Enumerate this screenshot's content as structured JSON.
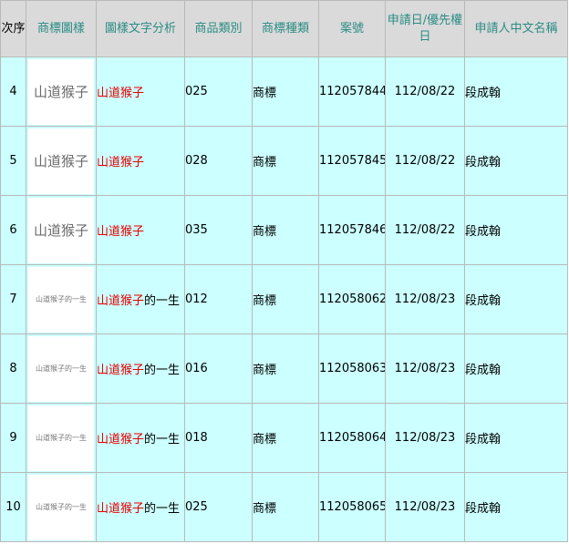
{
  "headers": {
    "seq": "次序",
    "image": "商標圖樣",
    "text": "圖樣文字分析",
    "class": "商品類別",
    "type": "商標種類",
    "app_no": "案號",
    "date": "申請日/優先權日",
    "applicant": "申請人中文名稱"
  },
  "rows": [
    {
      "seq": "4",
      "logo": "山道猴子",
      "text_red": "山道猴子",
      "text_rest": "",
      "class": "025",
      "type": "商標",
      "app_no": "112057844",
      "date": "112/08/22",
      "applicant": "段成翰"
    },
    {
      "seq": "5",
      "logo": "山道猴子",
      "text_red": "山道猴子",
      "text_rest": "",
      "class": "028",
      "type": "商標",
      "app_no": "112057845",
      "date": "112/08/22",
      "applicant": "段成翰"
    },
    {
      "seq": "6",
      "logo": "山道猴子",
      "text_red": "山道猴子",
      "text_rest": "",
      "class": "035",
      "type": "商標",
      "app_no": "112057846",
      "date": "112/08/22",
      "applicant": "段成翰"
    },
    {
      "seq": "7",
      "logo": "山道猴子的一生",
      "text_red": "山道猴子",
      "text_rest": "的一生",
      "class": "012",
      "type": "商標",
      "app_no": "112058062",
      "date": "112/08/23",
      "applicant": "段成翰"
    },
    {
      "seq": "8",
      "logo": "山道猴子的一生",
      "text_red": "山道猴子",
      "text_rest": "的一生",
      "class": "016",
      "type": "商標",
      "app_no": "112058063",
      "date": "112/08/23",
      "applicant": "段成翰"
    },
    {
      "seq": "9",
      "logo": "山道猴子的一生",
      "text_red": "山道猴子",
      "text_rest": "的一生",
      "class": "018",
      "type": "商標",
      "app_no": "112058064",
      "date": "112/08/23",
      "applicant": "段成翰"
    },
    {
      "seq": "10",
      "logo": "山道猴子的一生",
      "text_red": "山道猴子",
      "text_rest": "的一生",
      "class": "025",
      "type": "商標",
      "app_no": "112058065",
      "date": "112/08/23",
      "applicant": "段成翰"
    }
  ]
}
